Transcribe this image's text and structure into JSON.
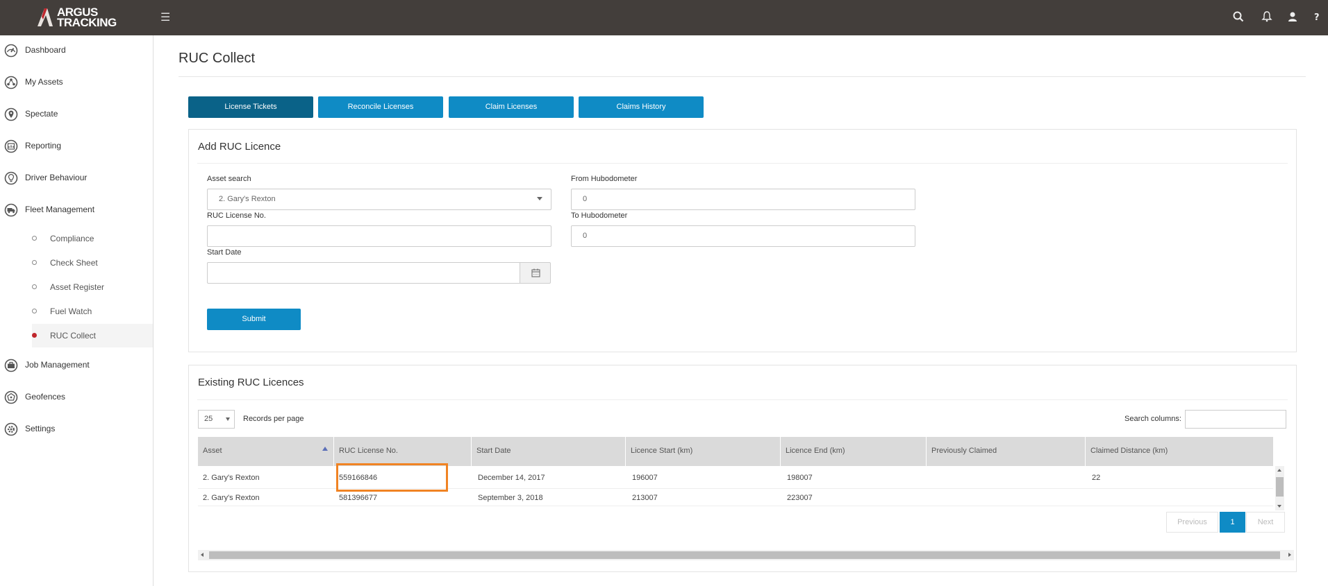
{
  "brand": {
    "line1": "ARGUS",
    "line2": "TRACKING"
  },
  "sidebar": {
    "items": [
      {
        "label": "Dashboard",
        "icon": "speedometer-icon"
      },
      {
        "label": "My Assets",
        "icon": "network-icon"
      },
      {
        "label": "Spectate",
        "icon": "map-pin-icon"
      },
      {
        "label": "Reporting",
        "icon": "report-icon"
      },
      {
        "label": "Driver Behaviour",
        "icon": "lightbulb-icon"
      },
      {
        "label": "Fleet Management",
        "icon": "truck-icon"
      }
    ],
    "sub_items": [
      {
        "label": "Compliance"
      },
      {
        "label": "Check Sheet"
      },
      {
        "label": "Asset Register"
      },
      {
        "label": "Fuel Watch"
      },
      {
        "label": "RUC Collect",
        "active": true
      }
    ],
    "items_after": [
      {
        "label": "Job Management",
        "icon": "briefcase-icon"
      },
      {
        "label": "Geofences",
        "icon": "geofence-icon"
      },
      {
        "label": "Settings",
        "icon": "gear-icon"
      }
    ]
  },
  "page": {
    "title": "RUC Collect"
  },
  "tabs": [
    {
      "label": "License Tickets",
      "active": true
    },
    {
      "label": "Reconcile Licenses"
    },
    {
      "label": "Claim Licenses"
    },
    {
      "label": "Claims History"
    }
  ],
  "add_form": {
    "title": "Add RUC Licence",
    "asset_search_label": "Asset search",
    "asset_search_value": "2. Gary's Rexton",
    "ruc_license_label": "RUC License No.",
    "ruc_license_value": "",
    "start_date_label": "Start Date",
    "start_date_value": "",
    "from_hub_label": "From Hubodometer",
    "from_hub_value": "0",
    "to_hub_label": "To Hubodometer",
    "to_hub_value": "0",
    "submit_label": "Submit"
  },
  "existing": {
    "title": "Existing RUC Licences",
    "per_page": "25",
    "per_page_label": "Records per page",
    "search_label": "Search columns:",
    "columns": [
      "Asset",
      "RUC License No.",
      "Start Date",
      "Licence Start (km)",
      "Licence End (km)",
      "Previously Claimed",
      "Claimed Distance (km)"
    ],
    "rows": [
      [
        "2. Gary's Rexton",
        "559166846",
        "December 14, 2017",
        "196007",
        "198007",
        "",
        "22"
      ],
      [
        "2. Gary's Rexton",
        "581396677",
        "September 3, 2018",
        "213007",
        "223007",
        "",
        ""
      ]
    ],
    "pagination": {
      "previous": "Previous",
      "current": "1",
      "next": "Next"
    }
  },
  "colors": {
    "topbar": "#433e3b",
    "accent": "#0f8bc5",
    "tab_active": "#0a6288",
    "highlight": "#f08323",
    "active_dot": "#c0272d"
  }
}
